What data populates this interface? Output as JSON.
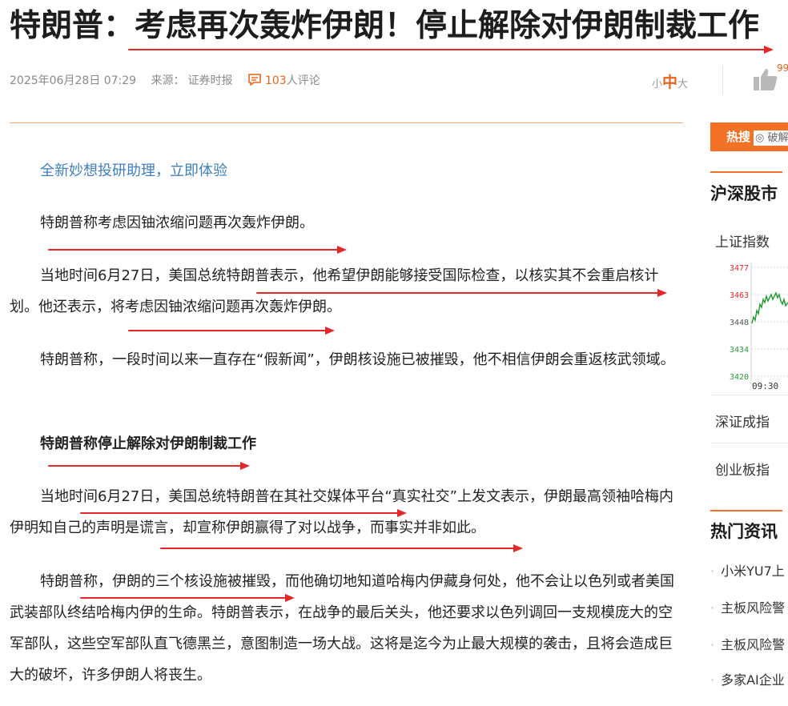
{
  "article": {
    "headline": "特朗普：考虑再次轰炸伊朗！停止解除对伊朗制裁工作",
    "meta": {
      "datetime": "2025年06月28日 07:29",
      "source_label": "来源：",
      "source": "证券时报",
      "comment_count": "103",
      "comment_suffix": "人评论"
    },
    "font_size_control": {
      "small": "小",
      "medium": "中",
      "large": "大"
    },
    "like_count": "99",
    "promo_link": "全新妙想投研助理，立即体验",
    "paragraphs": {
      "p1": "特朗普称考虑因铀浓缩问题再次轰炸伊朗。",
      "p2": "当地时间6月27日，美国总统特朗普表示，他希望伊朗能够接受国际检查，以核实其不会重启核计划。他还表示，将考虑因铀浓缩问题再次轰炸伊朗。",
      "p3": "特朗普称，一段时间以来一直存在“假新闻”，伊朗核设施已被摧毁，他不相信伊朗会重返核武领域。",
      "subheading": "特朗普称停止解除对伊朗制裁工作",
      "p4": "当地时间6月27日，美国总统特朗普在其社交媒体平台“真实社交”上发文表示，伊朗最高领袖哈梅内伊明知自己的声明是谎言，却宣称伊朗赢得了对以战争，而事实并非如此。",
      "p5": "特朗普称，伊朗的三个核设施被摧毁，而他确切地知道哈梅内伊藏身何处，他不会让以色列或者美国武装部队终结哈梅内伊的生命。特朗普表示，在战争的最后关头，他还要求以色列调回一支规模庞大的空军部队，这些空军部队直飞德黑兰，意图制造一场大战。这将是迄今为止最大规模的袭击，且将会造成巨大的破坏，许多伊朗人将丧生。"
    }
  },
  "sidebar": {
    "hot_search": {
      "tag": "热搜",
      "tail": "◎ 破解"
    },
    "market_title": "沪深股市",
    "index_items": [
      "上证指数",
      "深证成指",
      "创业板指"
    ],
    "chart": {
      "y_ticks": [
        "3477",
        "3463",
        "3448",
        "3434",
        "3420"
      ],
      "x_tick": "09:30"
    },
    "hot_news_title": "热门资讯",
    "hot_news": [
      "小米YU7上",
      "主板风险警",
      "主板风险警",
      "多家AI企业"
    ]
  },
  "colors": {
    "accent": "#f37127",
    "arrow": "#e4282a",
    "link": "#3f7fc1",
    "tick_up": "#e4282a",
    "tick_down": "#2a9a3a",
    "line": "#1f9a2f"
  },
  "icons": [
    "comment-icon",
    "thumbs-up-icon",
    "hot-search-icon"
  ]
}
